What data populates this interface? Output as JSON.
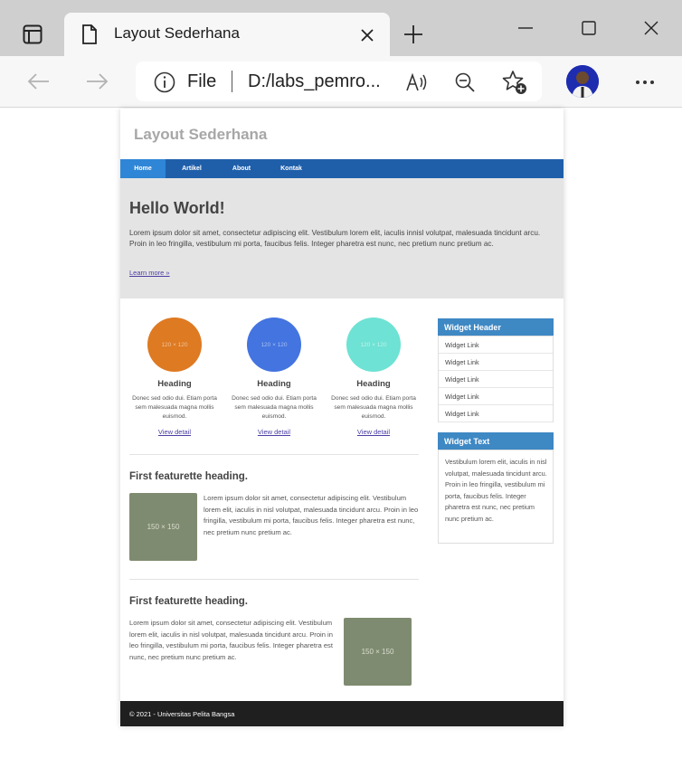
{
  "browser": {
    "tab_title": "Layout Sederhana",
    "url_scheme": "File",
    "url_path": "D:/labs_pemro..."
  },
  "site": {
    "title": "Layout Sederhana",
    "nav": [
      "Home",
      "Artikel",
      "About",
      "Kontak"
    ],
    "hero": {
      "title": "Hello World!",
      "text": "Lorem ipsum dolor sit amet, consectetur adipiscing elit. Vestibulum lorem elit, iaculis innisl volutpat, malesuada tincidunt arcu. Proin in leo fringilla, vestibulum mi porta, faucibus felis. Integer pharetra est nunc, nec pretium nunc pretium ac.",
      "link": "Learn more »"
    },
    "columns": [
      {
        "image_label": "120 × 120",
        "heading": "Heading",
        "text": "Donec sed odio dui. Etiam porta sem malesuada magna mollis euismod.",
        "link": "View detail",
        "color": "#de7a22"
      },
      {
        "image_label": "120 × 120",
        "heading": "Heading",
        "text": "Donec sed odio dui. Etiam porta sem malesuada magna mollis euismod.",
        "link": "View detail",
        "color": "#4374e0"
      },
      {
        "image_label": "120 × 120",
        "heading": "Heading",
        "text": "Donec sed odio dui. Etiam porta sem malesuada magna mollis euismod.",
        "link": "View detail",
        "color": "#6ee2d4"
      }
    ],
    "featurettes": [
      {
        "heading": "First featurette heading.",
        "image_label": "150 × 150",
        "text": "Lorem ipsum dolor sit amet, consectetur adipiscing elit. Vestibulum lorem elit, iaculis in nisl volutpat, malesuada tincidunt arcu. Proin in leo fringilla, vestibulum mi porta, faucibus felis. Integer pharetra est nunc, nec pretium nunc pretium ac."
      },
      {
        "heading": "First featurette heading.",
        "image_label": "150 × 150",
        "text": "Lorem ipsum dolor sit amet, consectetur adipiscing elit. Vestibulum lorem elit, iaculis in nisl volutpat, malesuada tincidunt arcu. Proin in leo fringilla, vestibulum mi porta, faucibus felis. Integer pharetra est nunc, nec pretium nunc pretium ac."
      }
    ],
    "widgets": {
      "header_title": "Widget Header",
      "links": [
        "Widget Link",
        "Widget Link",
        "Widget Link",
        "Widget Link",
        "Widget Link"
      ],
      "text_title": "Widget Text",
      "text": "Vestibulum lorem elit, iaculis in nisl volutpat, malesuada tincidunt arcu. Proin in leo fringilla, vestibulum mi porta, faucibus felis. Integer pharetra est nunc, nec pretium nunc pretium ac."
    },
    "footer": "© 2021 - Universitas Pelita Bangsa"
  },
  "colors": {
    "nav": "#1f5faa",
    "nav_active": "#2f86d6",
    "hero_bg": "#e4e4e4",
    "widget_header": "#3e88c4",
    "footer_bg": "#1f1f1f",
    "image_placeholder": "#7f8b70"
  }
}
